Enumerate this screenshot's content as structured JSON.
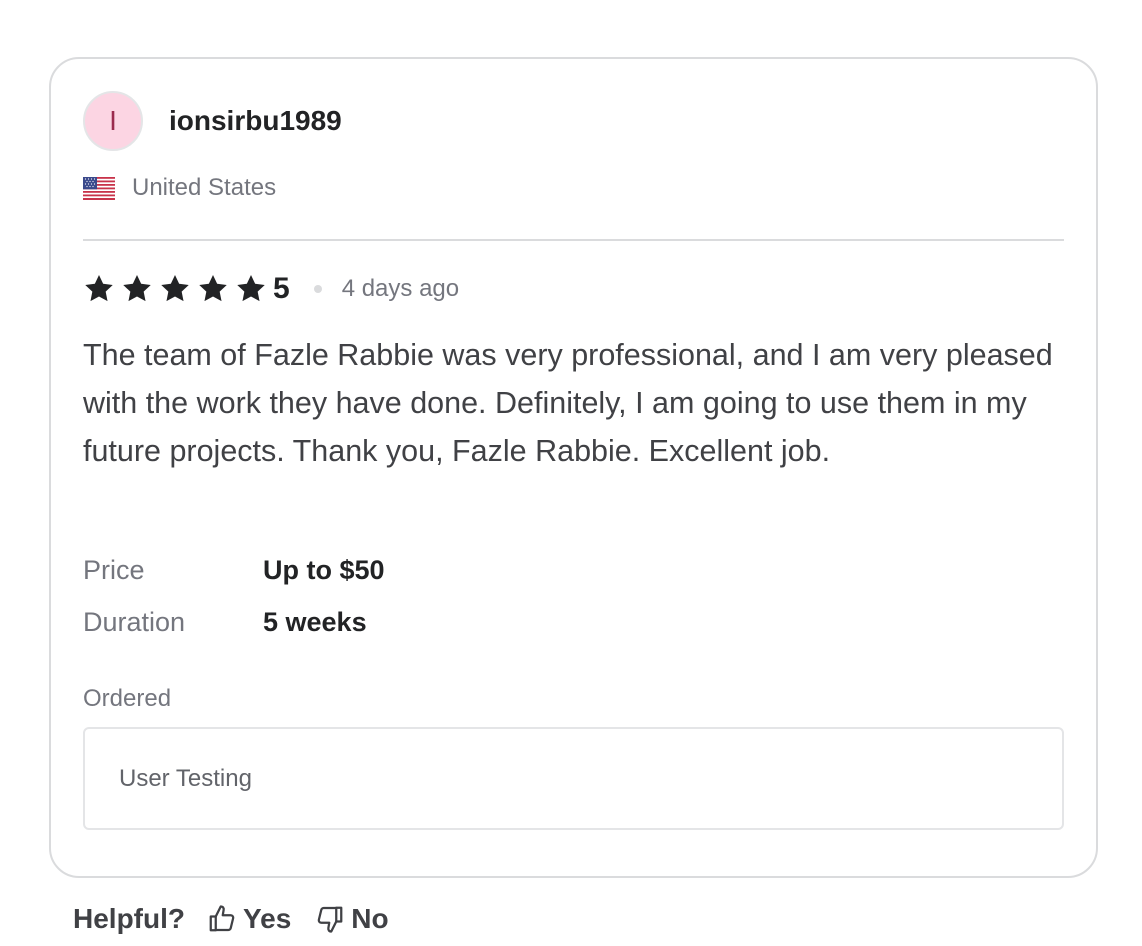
{
  "reviewer": {
    "avatar_initial": "I",
    "username": "ionsirbu1989",
    "country": "United States",
    "flag_icon": "us-flag-icon"
  },
  "rating": {
    "stars": 5,
    "value": "5",
    "time_ago": "4 days ago",
    "star_color": "#222325"
  },
  "review": {
    "text": "The team of Fazle Rabbie was very professional, and I am very pleased with the work they have done. Definitely, I am going to use them in my future projects. Thank you, Fazle Rabbie. Excellent job."
  },
  "details": {
    "price_label": "Price",
    "price_value": "Up to $50",
    "duration_label": "Duration",
    "duration_value": "5 weeks"
  },
  "ordered": {
    "label": "Ordered",
    "item": "User Testing"
  },
  "helpful": {
    "label": "Helpful?",
    "yes_label": "Yes",
    "no_label": "No",
    "yes_icon": "thumbs-up-icon",
    "no_icon": "thumbs-down-icon"
  },
  "colors": {
    "avatar_bg": "#fcd5e3",
    "avatar_text": "#9b2b4e",
    "border": "#dadbdd",
    "muted_text": "#74767e"
  }
}
